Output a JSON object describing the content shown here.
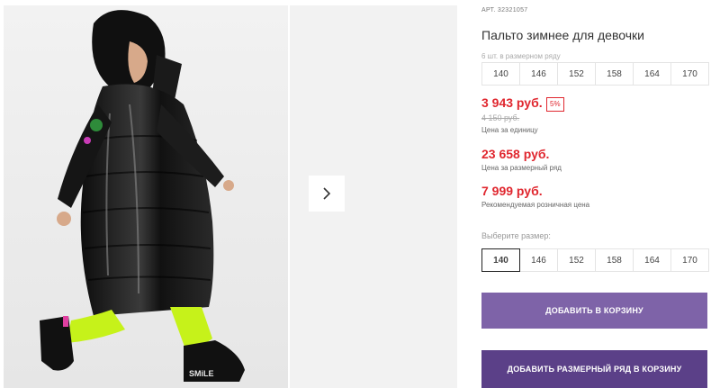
{
  "gallery": {
    "print_text": "SMiLE"
  },
  "product": {
    "article_label": "АРТ.",
    "article_number": "32321057",
    "title": "Пальто зимнее для девочки",
    "sizes_caption": "6 шт. в размерном ряду",
    "row_sizes": [
      "140",
      "146",
      "152",
      "158",
      "164",
      "170"
    ],
    "price_unit": "3 943 руб.",
    "discount_badge": "5%",
    "old_price": "4 150 руб.",
    "price_unit_note": "Цена за единицу",
    "price_row": "23 658 руб.",
    "price_row_note": "Цена за размерный ряд",
    "price_retail": "7 999 руб.",
    "price_retail_note": "Рекомендуемая розничная цена",
    "choose_size_label": "Выберите размер:",
    "pick_sizes": [
      "140",
      "146",
      "152",
      "158",
      "164",
      "170"
    ],
    "selected_size": "140",
    "add_to_cart": "ДОБАВИТЬ В КОРЗИНУ",
    "add_row_to_cart": "ДОБАВИТЬ РАЗМЕРНЫЙ РЯД В КОРЗИНУ"
  },
  "colors": {
    "price_red": "#e0272f",
    "button_primary": "#7e63a8",
    "button_secondary": "#5b4088",
    "neon_green": "#c6f21a"
  },
  "icons": {
    "next": "chevron-right-icon"
  }
}
